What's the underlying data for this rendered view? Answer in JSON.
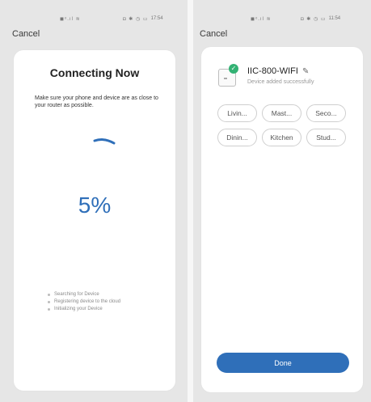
{
  "left_screen": {
    "status_bar": {
      "icons": "◼ᵒ.ıl ≋",
      "right_icons": "◘ ✱ ◷ ▭",
      "time": "17:54"
    },
    "cancel_label": "Cancel",
    "title": "Connecting Now",
    "description": "Make sure your phone and device are as close to your router as possible.",
    "progress_percent": 5,
    "progress_label": "5%",
    "steps": [
      {
        "label": "Searching for Device"
      },
      {
        "label": "Registering device to the cloud"
      },
      {
        "label": "Initializing your Device"
      }
    ]
  },
  "right_screen": {
    "status_bar": {
      "icons": "◼ᵒ.ıl ≋",
      "right_icons": "◘ ✱ ◷ ▭",
      "time": "11:54"
    },
    "cancel_label": "Cancel",
    "device_name": "IIC-800-WIFI",
    "device_status": "Device added successfully",
    "rooms": [
      "Livin...",
      "Mast...",
      "Seco...",
      "Dinin...",
      "Kitchen",
      "Stud..."
    ],
    "done_label": "Done"
  },
  "colors": {
    "accent": "#2f6fb9",
    "success": "#33b274"
  }
}
